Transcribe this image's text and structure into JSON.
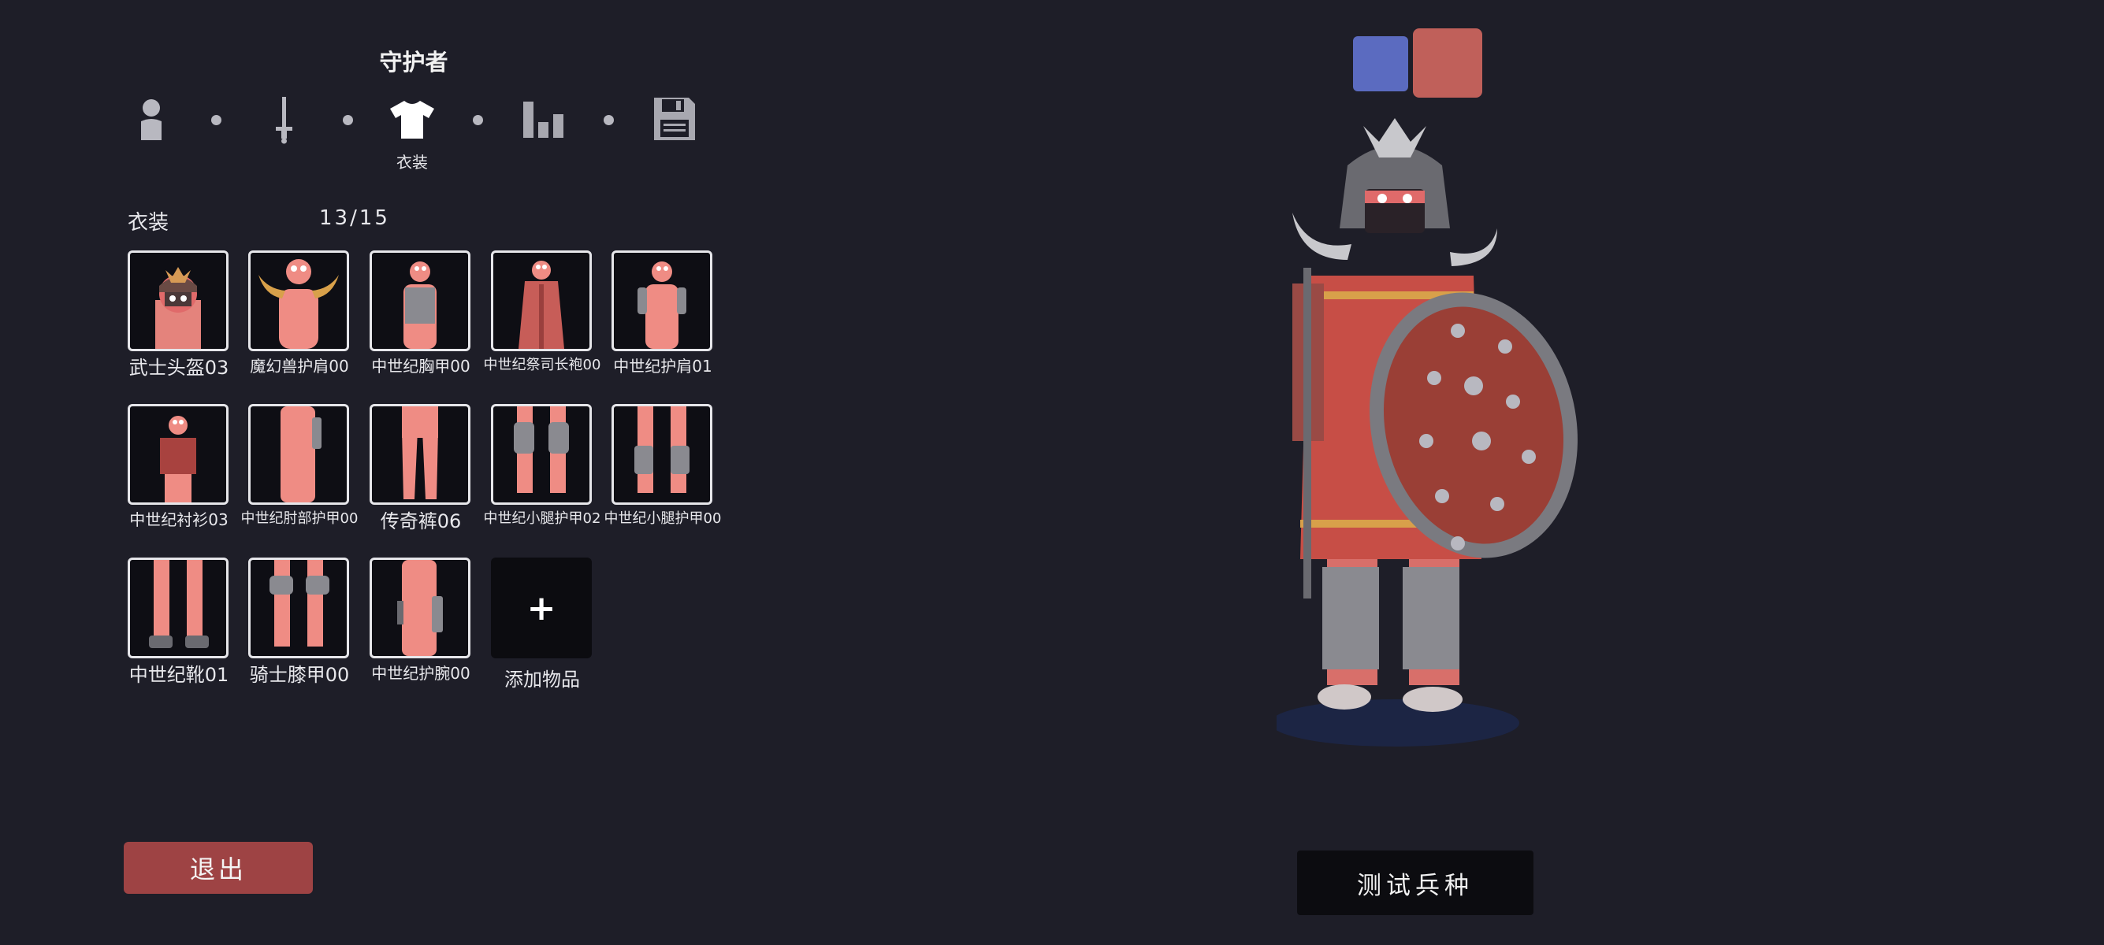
{
  "unit_name": "守护者",
  "steps": [
    {
      "icon": "person-icon"
    },
    {
      "icon": "sword-icon"
    },
    {
      "icon": "shirt-icon",
      "label": "衣装",
      "active": true
    },
    {
      "icon": "bar-chart-icon"
    },
    {
      "icon": "save-icon"
    }
  ],
  "section": {
    "title": "衣装",
    "count": "13/15"
  },
  "items": [
    {
      "label": "武士头盔03"
    },
    {
      "label": "魔幻兽护肩00"
    },
    {
      "label": "中世纪胸甲00"
    },
    {
      "label": "中世纪祭司长袍00"
    },
    {
      "label": "中世纪护肩01"
    },
    {
      "label": "中世纪衬衫03"
    },
    {
      "label": "中世纪肘部护甲00"
    },
    {
      "label": "传奇裤06"
    },
    {
      "label": "中世纪小腿护甲02"
    },
    {
      "label": "中世纪小腿护甲00"
    },
    {
      "label": "中世纪靴01"
    },
    {
      "label": "骑士膝甲00"
    },
    {
      "label": "中世纪护腕00"
    }
  ],
  "add_item": {
    "symbol": "+",
    "label": "添加物品"
  },
  "buttons": {
    "exit": "退出",
    "test": "测试兵种"
  },
  "colors": {
    "team_blue": "#5b6bc0",
    "team_red": "#c0605a",
    "exit": "#9e4344",
    "background": "#1e1e28"
  }
}
